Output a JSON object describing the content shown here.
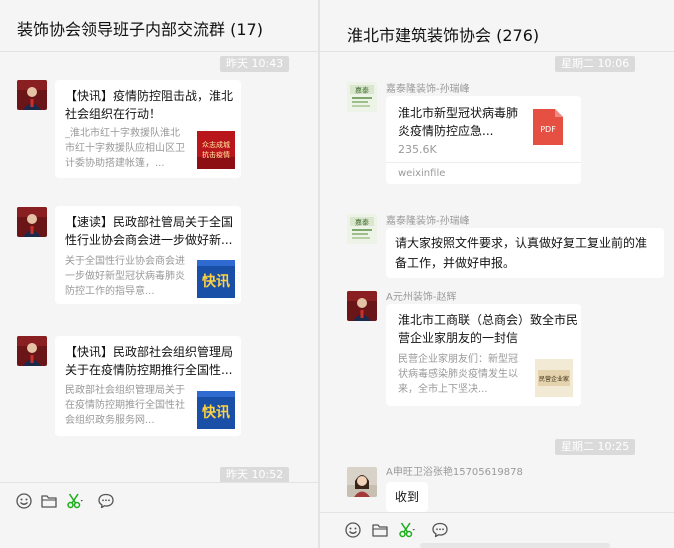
{
  "left_chat": {
    "title": "装饰协会领导班子内部交流群 (17)",
    "time_top": "昨天 10:43",
    "time_bottom": "昨天 10:52",
    "messages": [
      {
        "title": "【快讯】疫情防控阻击战，淮北社会组织在行动！",
        "desc": "_淮北市红十字救援队淮北市红十字救援队应相山区卫计委协助搭建帐篷，...",
        "thumb_text": "众志成城抗击疫情"
      },
      {
        "title": "【速读】民政部社管局关于全国性行业协会商会进一步做好新...",
        "desc": "关于全国性行业协会商会进一步做好新型冠状病毒肺炎防控工作的指导意...",
        "thumb_text": "快讯"
      },
      {
        "title": "【快讯】民政部社会组织管理局关于在疫情防控期推行全国性...",
        "desc": "民政部社会组织管理局关于在疫情防控期推行全国性社会组织政务服务网...",
        "thumb_text": "快讯"
      }
    ]
  },
  "right_chat": {
    "title": "淮北市建筑装饰协会 (276)",
    "time_top": "星期二 10:06",
    "time_bottom": "星期二 10:25",
    "file_message": {
      "sender": "嘉泰隆装饰-孙瑞峰",
      "avatar_text": "嘉泰",
      "file_name": "淮北市新型冠状病毒肺炎疫情防控应急...",
      "file_size": "235.6K",
      "file_badge": "PDF",
      "source": "weixinfile"
    },
    "text_message": {
      "sender": "嘉泰隆装饰-孙瑞峰",
      "avatar_text": "嘉泰",
      "text": "请大家按照文件要求，认真做好复工复业前的准备工作，并做好申报。"
    },
    "link_message": {
      "sender": "A元州装饰-赵辉",
      "title": "淮北市工商联（总商会）致全市民营企业家朋友的一封信",
      "desc": "民营企业家朋友们：新型冠状病毒感染肺炎疫情发生以来，全市上下坚决...",
      "thumb_text": "民营企业家"
    },
    "reply_message": {
      "sender": "A申旺卫浴张艳15705619878",
      "text": "收到"
    }
  },
  "toolbar": {
    "icons": [
      "emoji-icon",
      "folder-icon",
      "scissors-icon",
      "chat-history-icon"
    ]
  },
  "colors": {
    "background": "#f5f5f5",
    "bubble": "#ffffff",
    "time_badge": "#dadada",
    "pdf_red": "#e55042",
    "news_blue": "#1a4fa8",
    "news_red": "#c4161c",
    "scissors_green": "#1aad19"
  }
}
